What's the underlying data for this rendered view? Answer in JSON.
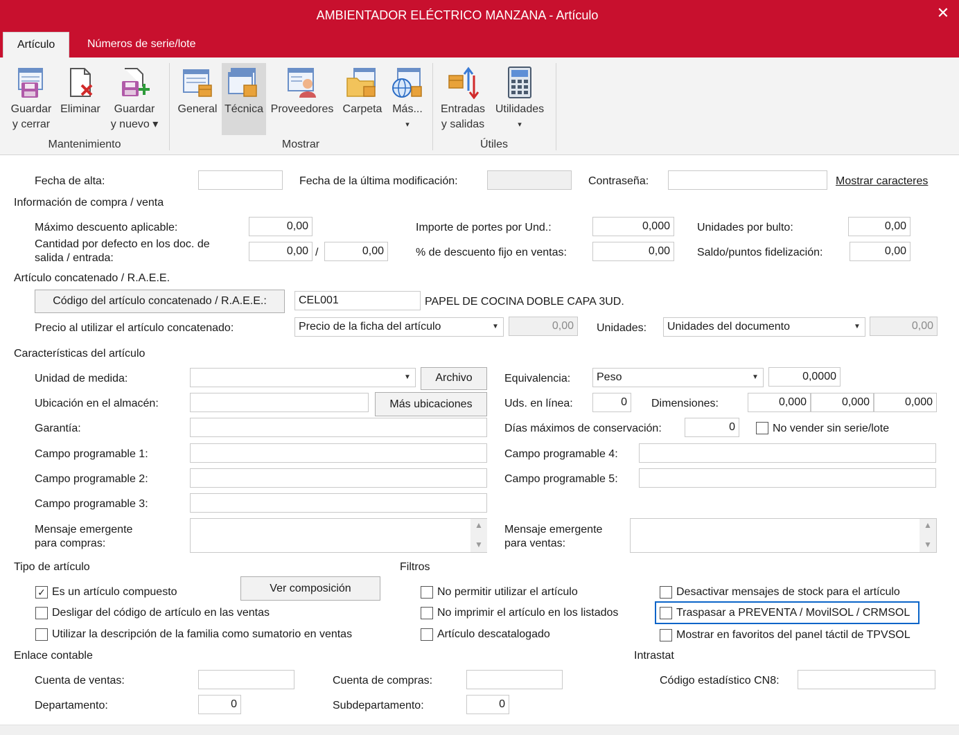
{
  "window": {
    "title": "AMBIENTADOR ELÉCTRICO MANZANA - Artículo",
    "close": "✕"
  },
  "tabs": [
    "Artículo",
    "Números de serie/lote"
  ],
  "ribbon": {
    "groups": [
      "Mantenimiento",
      "Mostrar",
      "Útiles"
    ],
    "buttons": {
      "save_close": [
        "Guardar",
        "y cerrar"
      ],
      "delete": [
        "Eliminar"
      ],
      "save_new": [
        "Guardar",
        "y nuevo ▾"
      ],
      "general": [
        "General"
      ],
      "tecnica": [
        "Técnica"
      ],
      "proveedores": [
        "Proveedores"
      ],
      "carpeta": [
        "Carpeta"
      ],
      "mas": [
        "Más...",
        "▾"
      ],
      "entradas": [
        "Entradas",
        "y salidas"
      ],
      "utilidades": [
        "Utilidades",
        "▾"
      ]
    }
  },
  "top": {
    "fecha_alta_label": "Fecha de alta:",
    "fecha_alta_value": "",
    "fecha_mod_label": "Fecha de la última modificación:",
    "fecha_mod_value": "",
    "contrasena_label": "Contraseña:",
    "contrasena_value": "",
    "mostrar_link": "Mostrar caracteres"
  },
  "compra_venta": {
    "section": "Información de compra / venta",
    "max_desc_label": "Máximo descuento aplicable:",
    "max_desc_value": "0,00",
    "cantidad_label_1": "Cantidad por defecto en los doc. de",
    "cantidad_label_2": "salida / entrada:",
    "cantidad_salida": "0,00",
    "slash": "/",
    "cantidad_entrada": "0,00",
    "portes_label": "Importe de portes por Und.:",
    "portes_value": "0,000",
    "desc_fijo_label": "% de descuento fijo en ventas:",
    "desc_fijo_value": "0,00",
    "bulto_label": "Unidades por bulto:",
    "bulto_value": "0,00",
    "saldo_label": "Saldo/puntos fidelización:",
    "saldo_value": "0,00"
  },
  "concatenado": {
    "section": "Artículo concatenado / R.A.E.E.",
    "codigo_button": "Código del artículo concatenado / R.A.E.E.:",
    "codigo_value": "CEL001",
    "descripcion": "PAPEL DE COCINA DOBLE CAPA 3UD.",
    "precio_label": "Precio al utilizar el artículo concatenado:",
    "precio_combo": "Precio de la ficha del artículo",
    "precio_value": "0,00",
    "unidades_label": "Unidades:",
    "unidades_combo": "Unidades del documento",
    "unidades_value": "0,00"
  },
  "caracteristicas": {
    "section": "Características del artículo",
    "unidad_medida_label": "Unidad de medida:",
    "unidad_medida_value": "",
    "archivo_button": "Archivo",
    "equivalencia_label": "Equivalencia:",
    "equivalencia_combo": "Peso",
    "equivalencia_value": "0,0000",
    "ubicacion_label": "Ubicación en el almacén:",
    "ubicacion_value": "",
    "mas_ubicaciones_button": "Más ubicaciones",
    "uds_linea_label": "Uds. en línea:",
    "uds_linea_value": "0",
    "dimensiones_label": "Dimensiones:",
    "dim1": "0,000",
    "dim2": "0,000",
    "dim3": "0,000",
    "garantia_label": "Garantía:",
    "garantia_value": "",
    "dias_label": "Días máximos de conservación:",
    "dias_value": "0",
    "no_vender_label": "No vender sin serie/lote",
    "campo1_label": "Campo programable 1:",
    "campo2_label": "Campo programable 2:",
    "campo3_label": "Campo programable 3:",
    "campo4_label": "Campo programable 4:",
    "campo5_label": "Campo programable 5:",
    "msg_compras_1": "Mensaje emergente",
    "msg_compras_2": "para compras:",
    "msg_ventas_1": "Mensaje emergente",
    "msg_ventas_2": "para ventas:"
  },
  "tipo": {
    "section": "Tipo de artículo",
    "compuesto_label": "Es un artículo compuesto",
    "compuesto_checked": "✓",
    "ver_composicion_button": "Ver composición",
    "desligar_label": "Desligar del código de artículo en las ventas",
    "familia_label": "Utilizar la descripción de la familia como sumatorio en ventas"
  },
  "filtros": {
    "section": "Filtros",
    "no_permitir_label": "No permitir utilizar el artículo",
    "no_imprimir_label": "No imprimir el artículo en los listados",
    "descatalogado_label": "Artículo descatalogado",
    "desactivar_stock_label": "Desactivar mensajes de stock para el artículo",
    "traspasar_label": "Traspasar a PREVENTA / MovilSOL / CRMSOL",
    "favoritos_label": "Mostrar en favoritos del panel táctil de TPVSOL"
  },
  "contable": {
    "section": "Enlace contable",
    "ventas_label": "Cuenta de ventas:",
    "compras_label": "Cuenta de compras:",
    "departamento_label": "Departamento:",
    "departamento_value": "0",
    "subdepartamento_label": "Subdepartamento:",
    "subdepartamento_value": "0"
  },
  "intrastat": {
    "section": "Intrastat",
    "cn8_label": "Código estadístico CN8:"
  },
  "colors": {
    "accent": "#c8102e",
    "focus": "#0a64c8"
  },
  "scroll": {
    "up": "▲",
    "down": "▼"
  }
}
